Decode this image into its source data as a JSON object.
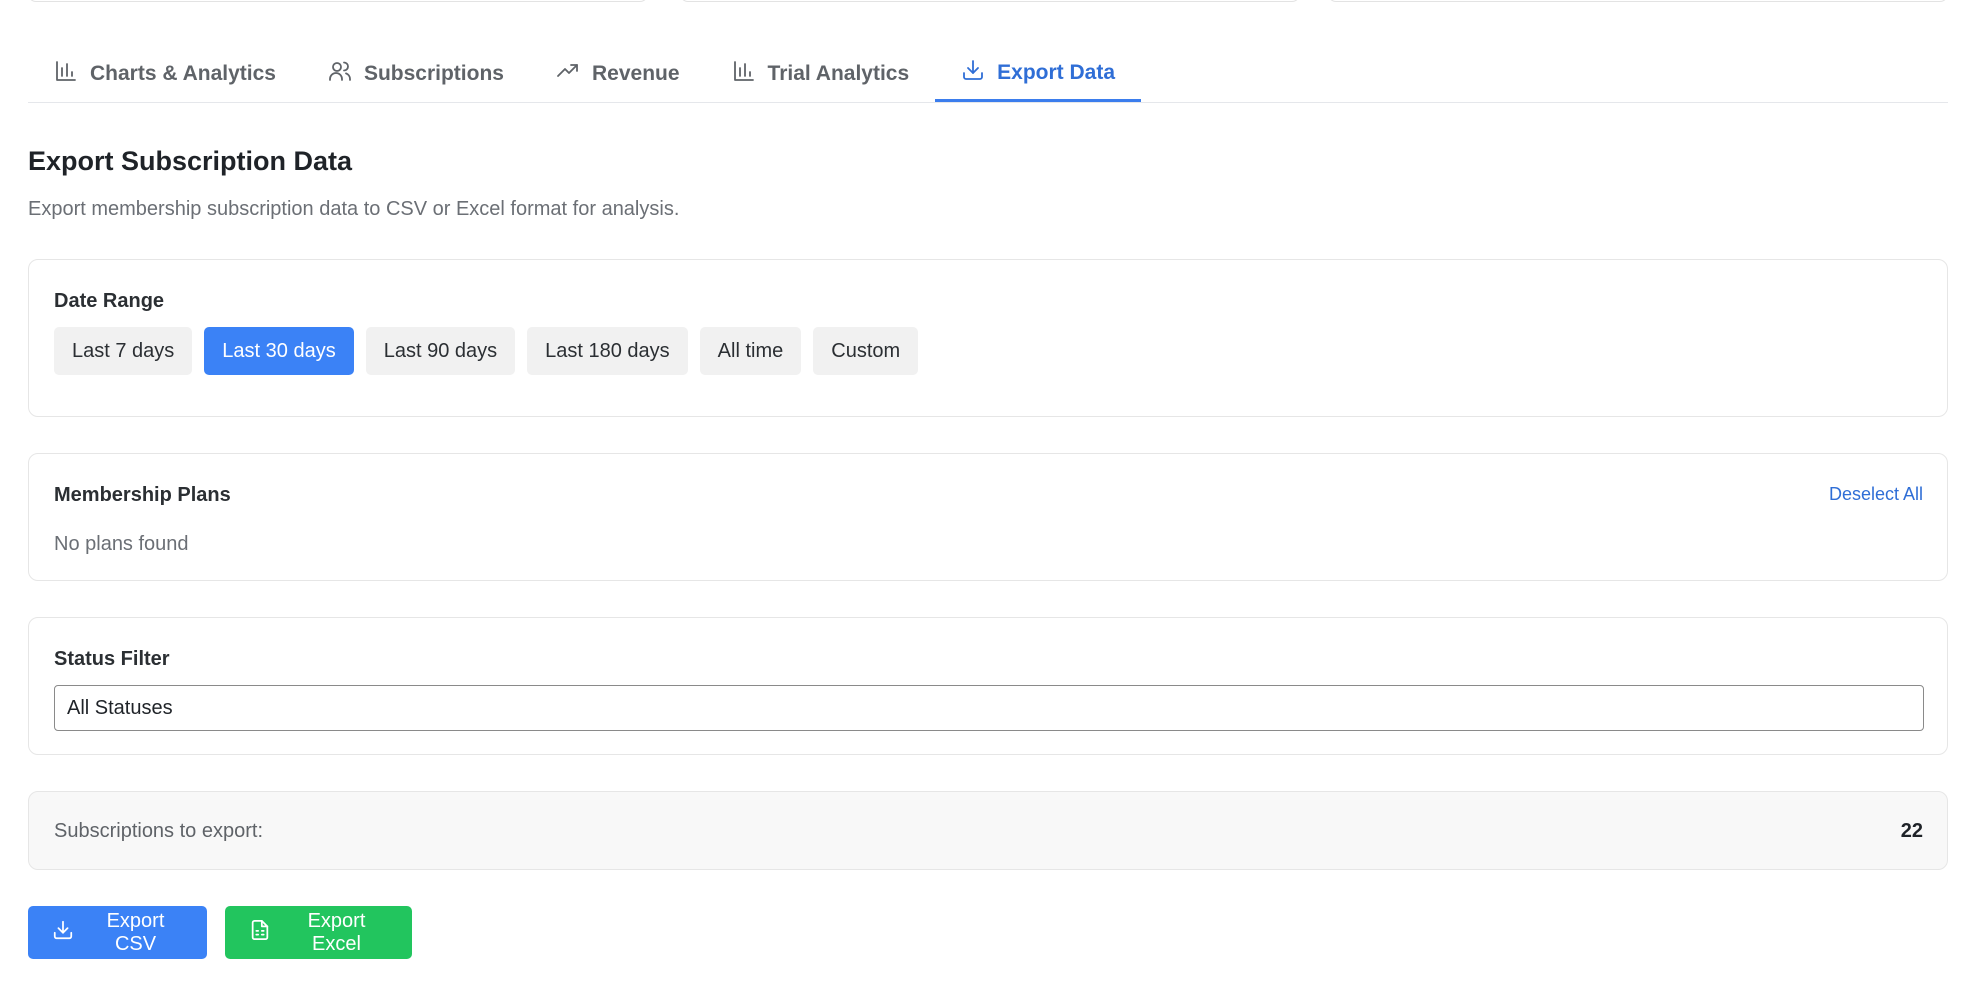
{
  "colors": {
    "accent": "#3b82f6",
    "accent_text": "#2f6ed6",
    "success": "#22c55e"
  },
  "tabs": [
    {
      "label": "Charts & Analytics",
      "icon": "bar-chart-icon",
      "active": false
    },
    {
      "label": "Subscriptions",
      "icon": "users-icon",
      "active": false
    },
    {
      "label": "Revenue",
      "icon": "trending-up-icon",
      "active": false
    },
    {
      "label": "Trial Analytics",
      "icon": "bar-chart-icon",
      "active": false
    },
    {
      "label": "Export Data",
      "icon": "download-icon",
      "active": true
    }
  ],
  "page": {
    "title": "Export Subscription Data",
    "description": "Export membership subscription data to CSV or Excel format for analysis."
  },
  "date_range": {
    "label": "Date Range",
    "options": [
      "Last 7 days",
      "Last 30 days",
      "Last 90 days",
      "Last 180 days",
      "All time",
      "Custom"
    ],
    "selected": "Last 30 days"
  },
  "plans": {
    "label": "Membership Plans",
    "deselect_label": "Deselect All",
    "empty_text": "No plans found"
  },
  "status_filter": {
    "label": "Status Filter",
    "value": "All Statuses"
  },
  "summary": {
    "label": "Subscriptions to export:",
    "count": "22"
  },
  "actions": {
    "csv_label": "Export CSV",
    "csv_icon": "download-icon",
    "excel_label": "Export Excel",
    "excel_icon": "file-spreadsheet-icon"
  }
}
